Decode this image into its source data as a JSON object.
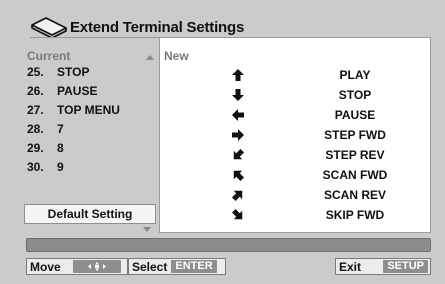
{
  "title": "Extend Terminal Settings",
  "left_panel": {
    "current_label": "Current",
    "items": [
      {
        "num": "25.",
        "label": "STOP"
      },
      {
        "num": "26.",
        "label": "PAUSE"
      },
      {
        "num": "27.",
        "label": "TOP MENU"
      },
      {
        "num": "28.",
        "label": "7"
      },
      {
        "num": "29.",
        "label": "8"
      },
      {
        "num": "30.",
        "label": "9"
      }
    ],
    "default_button": "Default Setting"
  },
  "right_panel": {
    "new_label": "New",
    "rows": [
      {
        "arrow": "arrow-up-icon",
        "label": "PLAY"
      },
      {
        "arrow": "arrow-down-icon",
        "label": "STOP"
      },
      {
        "arrow": "arrow-left-icon",
        "label": "PAUSE"
      },
      {
        "arrow": "arrow-right-icon",
        "label": "STEP FWD"
      },
      {
        "arrow": "arrow-down-left-icon",
        "label": "STEP REV"
      },
      {
        "arrow": "arrow-up-left-icon",
        "label": "SCAN FWD"
      },
      {
        "arrow": "arrow-up-right-icon",
        "label": "SCAN REV"
      },
      {
        "arrow": "arrow-down-right-icon",
        "label": "SKIP FWD"
      }
    ]
  },
  "footer": {
    "move_label": "Move",
    "move_key": "joystick-icon",
    "select_label": "Select",
    "select_key": "ENTER",
    "exit_label": "Exit",
    "exit_key": "SETUP"
  },
  "colors": {
    "background": "#cbcbcb",
    "panel": "#ffffff",
    "key_bg": "#8e8e8e",
    "status_bar": "#8d8d8d"
  }
}
